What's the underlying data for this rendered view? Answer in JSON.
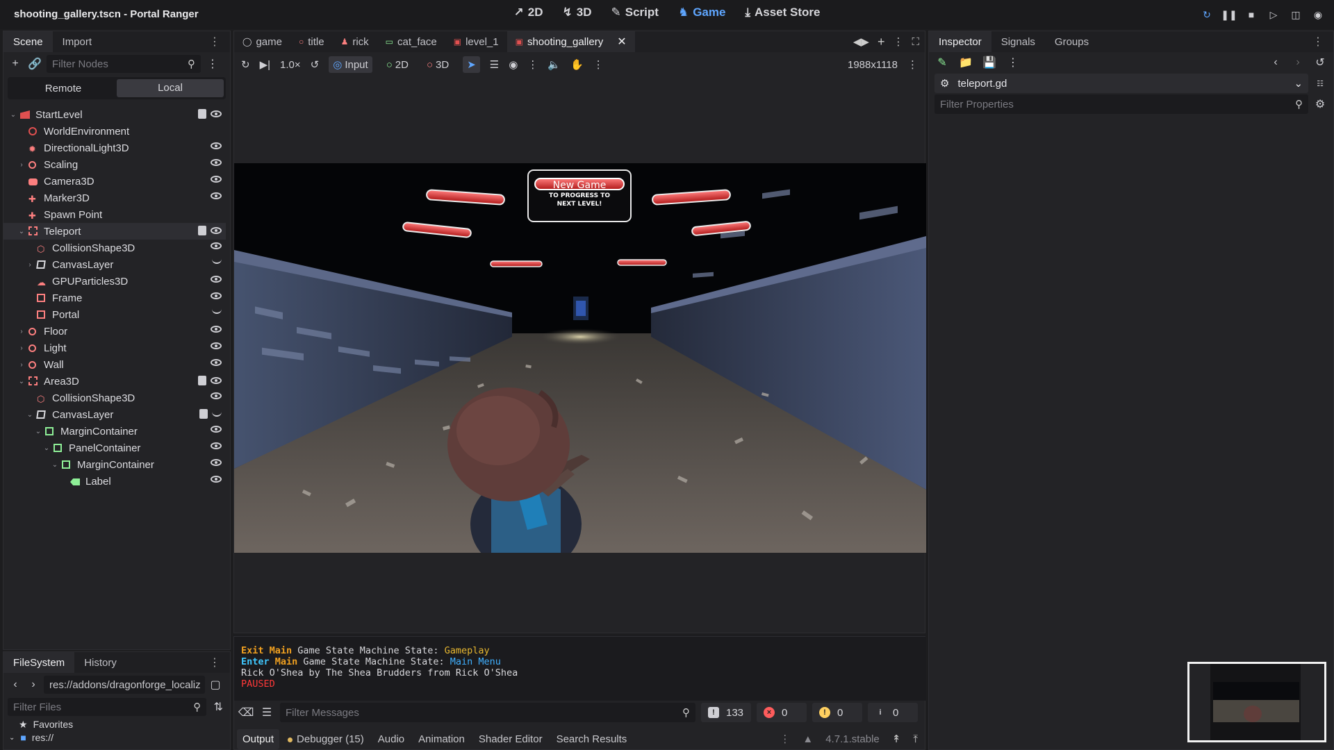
{
  "window": {
    "title": "shooting_gallery.tscn - Portal Ranger"
  },
  "modes": [
    {
      "label": "2D",
      "icon": "2d-icon",
      "active": false
    },
    {
      "label": "3D",
      "icon": "3d-icon",
      "active": false
    },
    {
      "label": "Script",
      "icon": "script-icon",
      "active": false
    },
    {
      "label": "Game",
      "icon": "game-icon",
      "active": true
    },
    {
      "label": "Asset Store",
      "icon": "asset-store-icon",
      "active": false
    }
  ],
  "scene_dock": {
    "tabs": [
      "Scene",
      "Import"
    ],
    "filter_placeholder": "Filter Nodes",
    "remote_label": "Remote",
    "local_label": "Local",
    "tree": [
      {
        "label": "StartLevel",
        "depth": 0,
        "arrow": "v",
        "icon": "level",
        "color": "#e05050",
        "script": true,
        "eye": "open"
      },
      {
        "label": "WorldEnvironment",
        "depth": 1,
        "arrow": "",
        "icon": "globe",
        "color": "#e05050",
        "script": false,
        "eye": ""
      },
      {
        "label": "DirectionalLight3D",
        "depth": 1,
        "arrow": "",
        "icon": "sun",
        "color": "#fc7f7f",
        "script": false,
        "eye": "open"
      },
      {
        "label": "Scaling",
        "depth": 1,
        "arrow": ">",
        "icon": "circle",
        "color": "#fc7f7f",
        "script": false,
        "eye": "open"
      },
      {
        "label": "Camera3D",
        "depth": 1,
        "arrow": "",
        "icon": "camera",
        "color": "#fc7f7f",
        "script": false,
        "eye": "open"
      },
      {
        "label": "Marker3D",
        "depth": 1,
        "arrow": "",
        "icon": "cross",
        "color": "#fc7f7f",
        "script": false,
        "eye": "open"
      },
      {
        "label": "Spawn Point",
        "depth": 1,
        "arrow": "",
        "icon": "cross",
        "color": "#fc7f7f",
        "script": false,
        "eye": ""
      },
      {
        "label": "Teleport",
        "depth": 1,
        "arrow": "v",
        "icon": "area",
        "color": "#fc7f7f",
        "script": true,
        "eye": "open",
        "selected": true
      },
      {
        "label": "CollisionShape3D",
        "depth": 2,
        "arrow": "",
        "icon": "cube",
        "color": "#fc7f7f",
        "script": false,
        "eye": "open"
      },
      {
        "label": "CanvasLayer",
        "depth": 2,
        "arrow": ">",
        "icon": "canvas",
        "color": "#d8d8dc",
        "script": false,
        "eye": "closed"
      },
      {
        "label": "GPUParticles3D",
        "depth": 2,
        "arrow": "",
        "icon": "particles",
        "color": "#fc7f7f",
        "script": false,
        "eye": "open"
      },
      {
        "label": "Frame",
        "depth": 2,
        "arrow": "",
        "icon": "frame",
        "color": "#fc7f7f",
        "script": false,
        "eye": "open"
      },
      {
        "label": "Portal",
        "depth": 2,
        "arrow": "",
        "icon": "frame",
        "color": "#fc7f7f",
        "script": false,
        "eye": "closed"
      },
      {
        "label": "Floor",
        "depth": 1,
        "arrow": ">",
        "icon": "circle",
        "color": "#fc7f7f",
        "script": false,
        "eye": "open"
      },
      {
        "label": "Light",
        "depth": 1,
        "arrow": ">",
        "icon": "circle",
        "color": "#fc7f7f",
        "script": false,
        "eye": "open"
      },
      {
        "label": "Wall",
        "depth": 1,
        "arrow": ">",
        "icon": "circle",
        "color": "#fc7f7f",
        "script": false,
        "eye": "open"
      },
      {
        "label": "Area3D",
        "depth": 1,
        "arrow": "v",
        "icon": "area",
        "color": "#fc7f7f",
        "script": true,
        "eye": "open"
      },
      {
        "label": "CollisionShape3D",
        "depth": 2,
        "arrow": "",
        "icon": "cube",
        "color": "#fc7f7f",
        "script": false,
        "eye": "open"
      },
      {
        "label": "CanvasLayer",
        "depth": 2,
        "arrow": "v",
        "icon": "canvas",
        "color": "#d8d8dc",
        "script": true,
        "eye": "closed"
      },
      {
        "label": "MarginContainer",
        "depth": 3,
        "arrow": "v",
        "icon": "box",
        "color": "#8eef97",
        "script": false,
        "eye": "open"
      },
      {
        "label": "PanelContainer",
        "depth": 4,
        "arrow": "v",
        "icon": "box",
        "color": "#8eef97",
        "script": false,
        "eye": "open"
      },
      {
        "label": "MarginContainer",
        "depth": 5,
        "arrow": "v",
        "icon": "box",
        "color": "#8eef97",
        "script": false,
        "eye": "open"
      },
      {
        "label": "Label",
        "depth": 6,
        "arrow": "",
        "icon": "label",
        "color": "#8eef97",
        "script": false,
        "eye": "open"
      }
    ]
  },
  "filesystem": {
    "tabs": [
      "FileSystem",
      "History"
    ],
    "path": "res://addons/dragonforge_localiz",
    "filter_placeholder": "Filter Files",
    "favorites_label": "Favorites",
    "root_label": "res://"
  },
  "scene_tabs": [
    {
      "label": "game",
      "icon": "node-icon",
      "active": false
    },
    {
      "label": "title",
      "icon": "circle-icon",
      "active": false
    },
    {
      "label": "rick",
      "icon": "character-icon",
      "active": false
    },
    {
      "label": "cat_face",
      "icon": "control-icon",
      "active": false
    },
    {
      "label": "level_1",
      "icon": "level-icon",
      "active": false
    },
    {
      "label": "shooting_gallery",
      "icon": "level-icon",
      "active": true
    }
  ],
  "viewport_toolbar": {
    "speed": "1.0×",
    "input_label": "Input",
    "twod_label": "2D",
    "threed_label": "3D",
    "resolution": "1988x1118"
  },
  "game": {
    "title_button": "New Game",
    "title_sub": "TO PROGRESS TO NEXT LEVEL!"
  },
  "output": {
    "lines": [
      [
        {
          "t": "Exit ",
          "c": "c-orange"
        },
        {
          "t": "Main",
          "c": "c-orange"
        },
        {
          "t": " Game State Machine State: ",
          "c": ""
        },
        {
          "t": "Gameplay",
          "c": "c-yellow"
        }
      ],
      [
        {
          "t": "Enter ",
          "c": "c-cyan"
        },
        {
          "t": "Main",
          "c": "c-orange"
        },
        {
          "t": " Game State Machine State: ",
          "c": ""
        },
        {
          "t": "Main Menu",
          "c": "c-blue"
        }
      ],
      [
        {
          "t": "Rick O'Shea by The Shea Brudders from Rick O'Shea",
          "c": ""
        }
      ],
      [
        {
          "t": "PAUSED",
          "c": "c-red"
        }
      ]
    ],
    "filter_placeholder": "Filter Messages",
    "count_messages": "133",
    "count_errors": "0",
    "count_warnings": "0",
    "count_info": "0"
  },
  "bottom_tabs": [
    {
      "label": "Output",
      "active": true
    },
    {
      "label": "Debugger (15)",
      "active": false,
      "dot": true
    },
    {
      "label": "Audio",
      "active": false
    },
    {
      "label": "Animation",
      "active": false
    },
    {
      "label": "Shader Editor",
      "active": false
    },
    {
      "label": "Search Results",
      "active": false
    }
  ],
  "version": "4.7.1.stable",
  "inspector": {
    "tabs": [
      "Inspector",
      "Signals",
      "Groups"
    ],
    "resource": "teleport.gd",
    "filter_placeholder": "Filter Properties"
  },
  "colors": {
    "accent": "#5fa6ff",
    "node3d": "#fc7f7f",
    "control": "#8eef97"
  }
}
